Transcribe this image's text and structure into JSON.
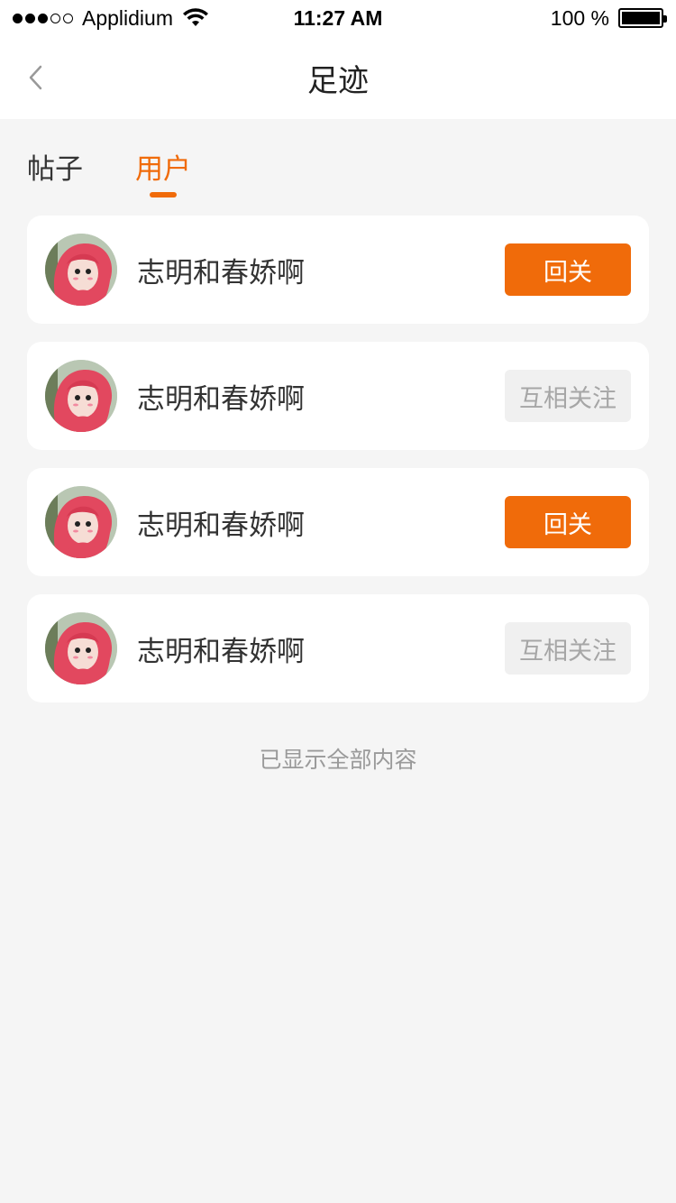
{
  "status_bar": {
    "carrier": "Applidium",
    "time": "11:27 AM",
    "battery": "100 %"
  },
  "nav": {
    "title": "足迹",
    "back_icon": "chevron-left-icon"
  },
  "tabs": [
    {
      "label": "帖子",
      "active": false
    },
    {
      "label": "用户",
      "active": true
    }
  ],
  "users": [
    {
      "name": "志明和春娇啊",
      "action": "回关",
      "style": "primary"
    },
    {
      "name": "志明和春娇啊",
      "action": "互相关注",
      "style": "secondary"
    },
    {
      "name": "志明和春娇啊",
      "action": "回关",
      "style": "primary"
    },
    {
      "name": "志明和春娇啊",
      "action": "互相关注",
      "style": "secondary"
    }
  ],
  "footer": "已显示全部内容",
  "colors": {
    "accent": "#f06b0a",
    "background": "#f5f5f5",
    "muted_button": "#f0f0f0"
  }
}
